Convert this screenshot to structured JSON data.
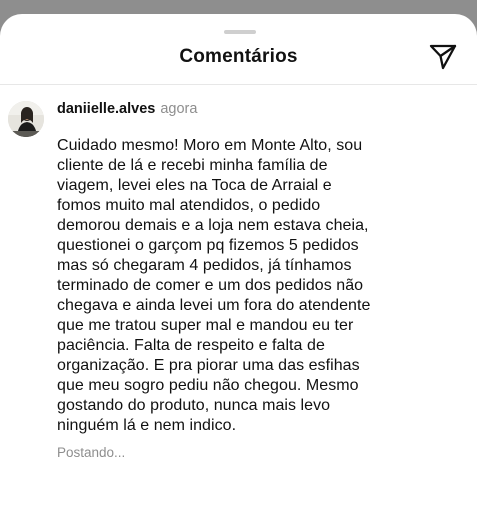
{
  "header": {
    "title": "Comentários",
    "send_icon": "send-paper-plane-icon"
  },
  "comment": {
    "avatar_icon": "user-avatar",
    "username": "daniielle.alves",
    "timestamp": "agora",
    "text": "Cuidado mesmo! Moro em Monte Alto, sou\ncliente de lá  e recebi minha família de\nviagem, levei eles na Toca de Arraial e\nfomos muito mal atendidos, o pedido\ndemorou demais e a loja nem estava cheia,\nquestionei o garçom pq fizemos 5 pedidos\nmas só chegaram 4 pedidos, já tínhamos\nterminado de comer e um dos pedidos não\nchegava e ainda levei um fora do atendente\nque me tratou super mal e mandou eu ter\npaciência. Falta de respeito e falta de\norganização. E pra piorar uma das esfihas\nque meu sogro pediu não chegou. Mesmo\ngostando do produto, nunca mais levo\nninguém lá e nem indico.",
    "status": "Postando..."
  }
}
